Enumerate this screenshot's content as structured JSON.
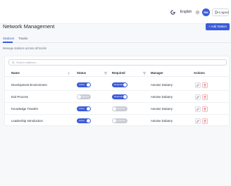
{
  "topbar": {
    "language": "English",
    "avatar_initials": "RM",
    "logout_label": "Logout"
  },
  "header": {
    "title": "Network Management",
    "add_button_label": "+ Add Station"
  },
  "tabs": [
    {
      "label": "Stations",
      "active": true
    },
    {
      "label": "Tracks",
      "active": false
    }
  ],
  "subtitle": "Manage stations across all tracks",
  "search": {
    "placeholder": "Search stations..."
  },
  "table": {
    "columns": [
      "Name",
      "Status",
      "Required",
      "Manager",
      "Actions"
    ],
    "rows": [
      {
        "name": "Development Environment",
        "status": "Active",
        "status_on": true,
        "required": "Required",
        "required_on": true,
        "manager": "Antoine Dubarry"
      },
      {
        "name": "Exit Process",
        "status": "Inactive",
        "status_on": false,
        "required": "Required",
        "required_on": true,
        "manager": "Antoine Dubarry"
      },
      {
        "name": "Knowledge Transfer",
        "status": "Active",
        "status_on": true,
        "required": "Optional",
        "required_on": false,
        "manager": "Antoine Dubarry"
      },
      {
        "name": "Leadership Introduction",
        "status": "Active",
        "status_on": true,
        "required": "Optional",
        "required_on": false,
        "manager": "Antoine Dubarry"
      }
    ]
  },
  "colors": {
    "accent": "#3b5bdb",
    "toggle_off": "#c9cdd3",
    "delete": "#e03131"
  }
}
